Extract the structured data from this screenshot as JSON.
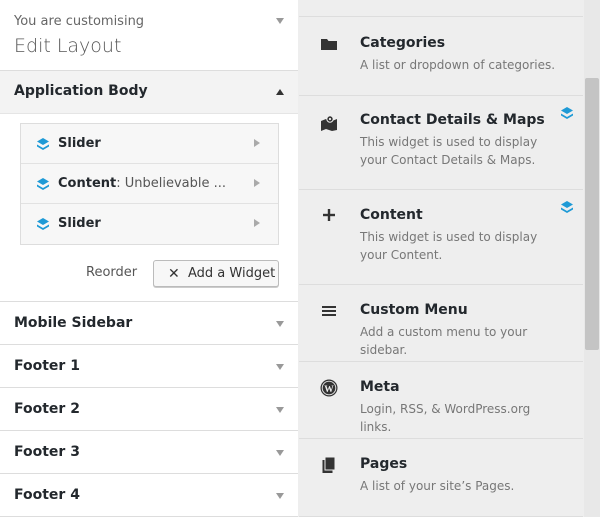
{
  "header": {
    "customising_label": "You are customising",
    "title": "Edit Layout"
  },
  "application_body": {
    "title": "Application Body",
    "widgets": [
      {
        "name": "Slider",
        "detail": ""
      },
      {
        "name": "Content",
        "detail": ": Unbelievable ..."
      },
      {
        "name": "Slider",
        "detail": ""
      }
    ],
    "reorder_label": "Reorder",
    "add_widget_label": "Add a Widget"
  },
  "sections": [
    {
      "title": "Mobile Sidebar"
    },
    {
      "title": "Footer 1"
    },
    {
      "title": "Footer 2"
    },
    {
      "title": "Footer 3"
    },
    {
      "title": "Footer 4"
    }
  ],
  "available_widgets": [
    {
      "name": "Categories",
      "desc": "A list or dropdown of categories.",
      "icon": "folder-icon",
      "badge": false
    },
    {
      "name": "Contact Details & Maps",
      "desc": "This widget is used to display your Contact Details & Maps.",
      "icon": "map-marker-icon",
      "badge": true
    },
    {
      "name": "Content",
      "desc": "This widget is used to display your Content.",
      "icon": "plus-icon",
      "badge": true
    },
    {
      "name": "Custom Menu",
      "desc": "Add a custom menu to your sidebar.",
      "icon": "menu-icon",
      "badge": false
    },
    {
      "name": "Meta",
      "desc": "Login, RSS, & WordPress.org links.",
      "icon": "wordpress-icon",
      "badge": false
    },
    {
      "name": "Pages",
      "desc": "A list of your site’s Pages.",
      "icon": "pages-icon",
      "badge": false
    }
  ],
  "colors": {
    "accent_blue": "#1e9ad6",
    "panel_bg": "#eeeeee"
  }
}
